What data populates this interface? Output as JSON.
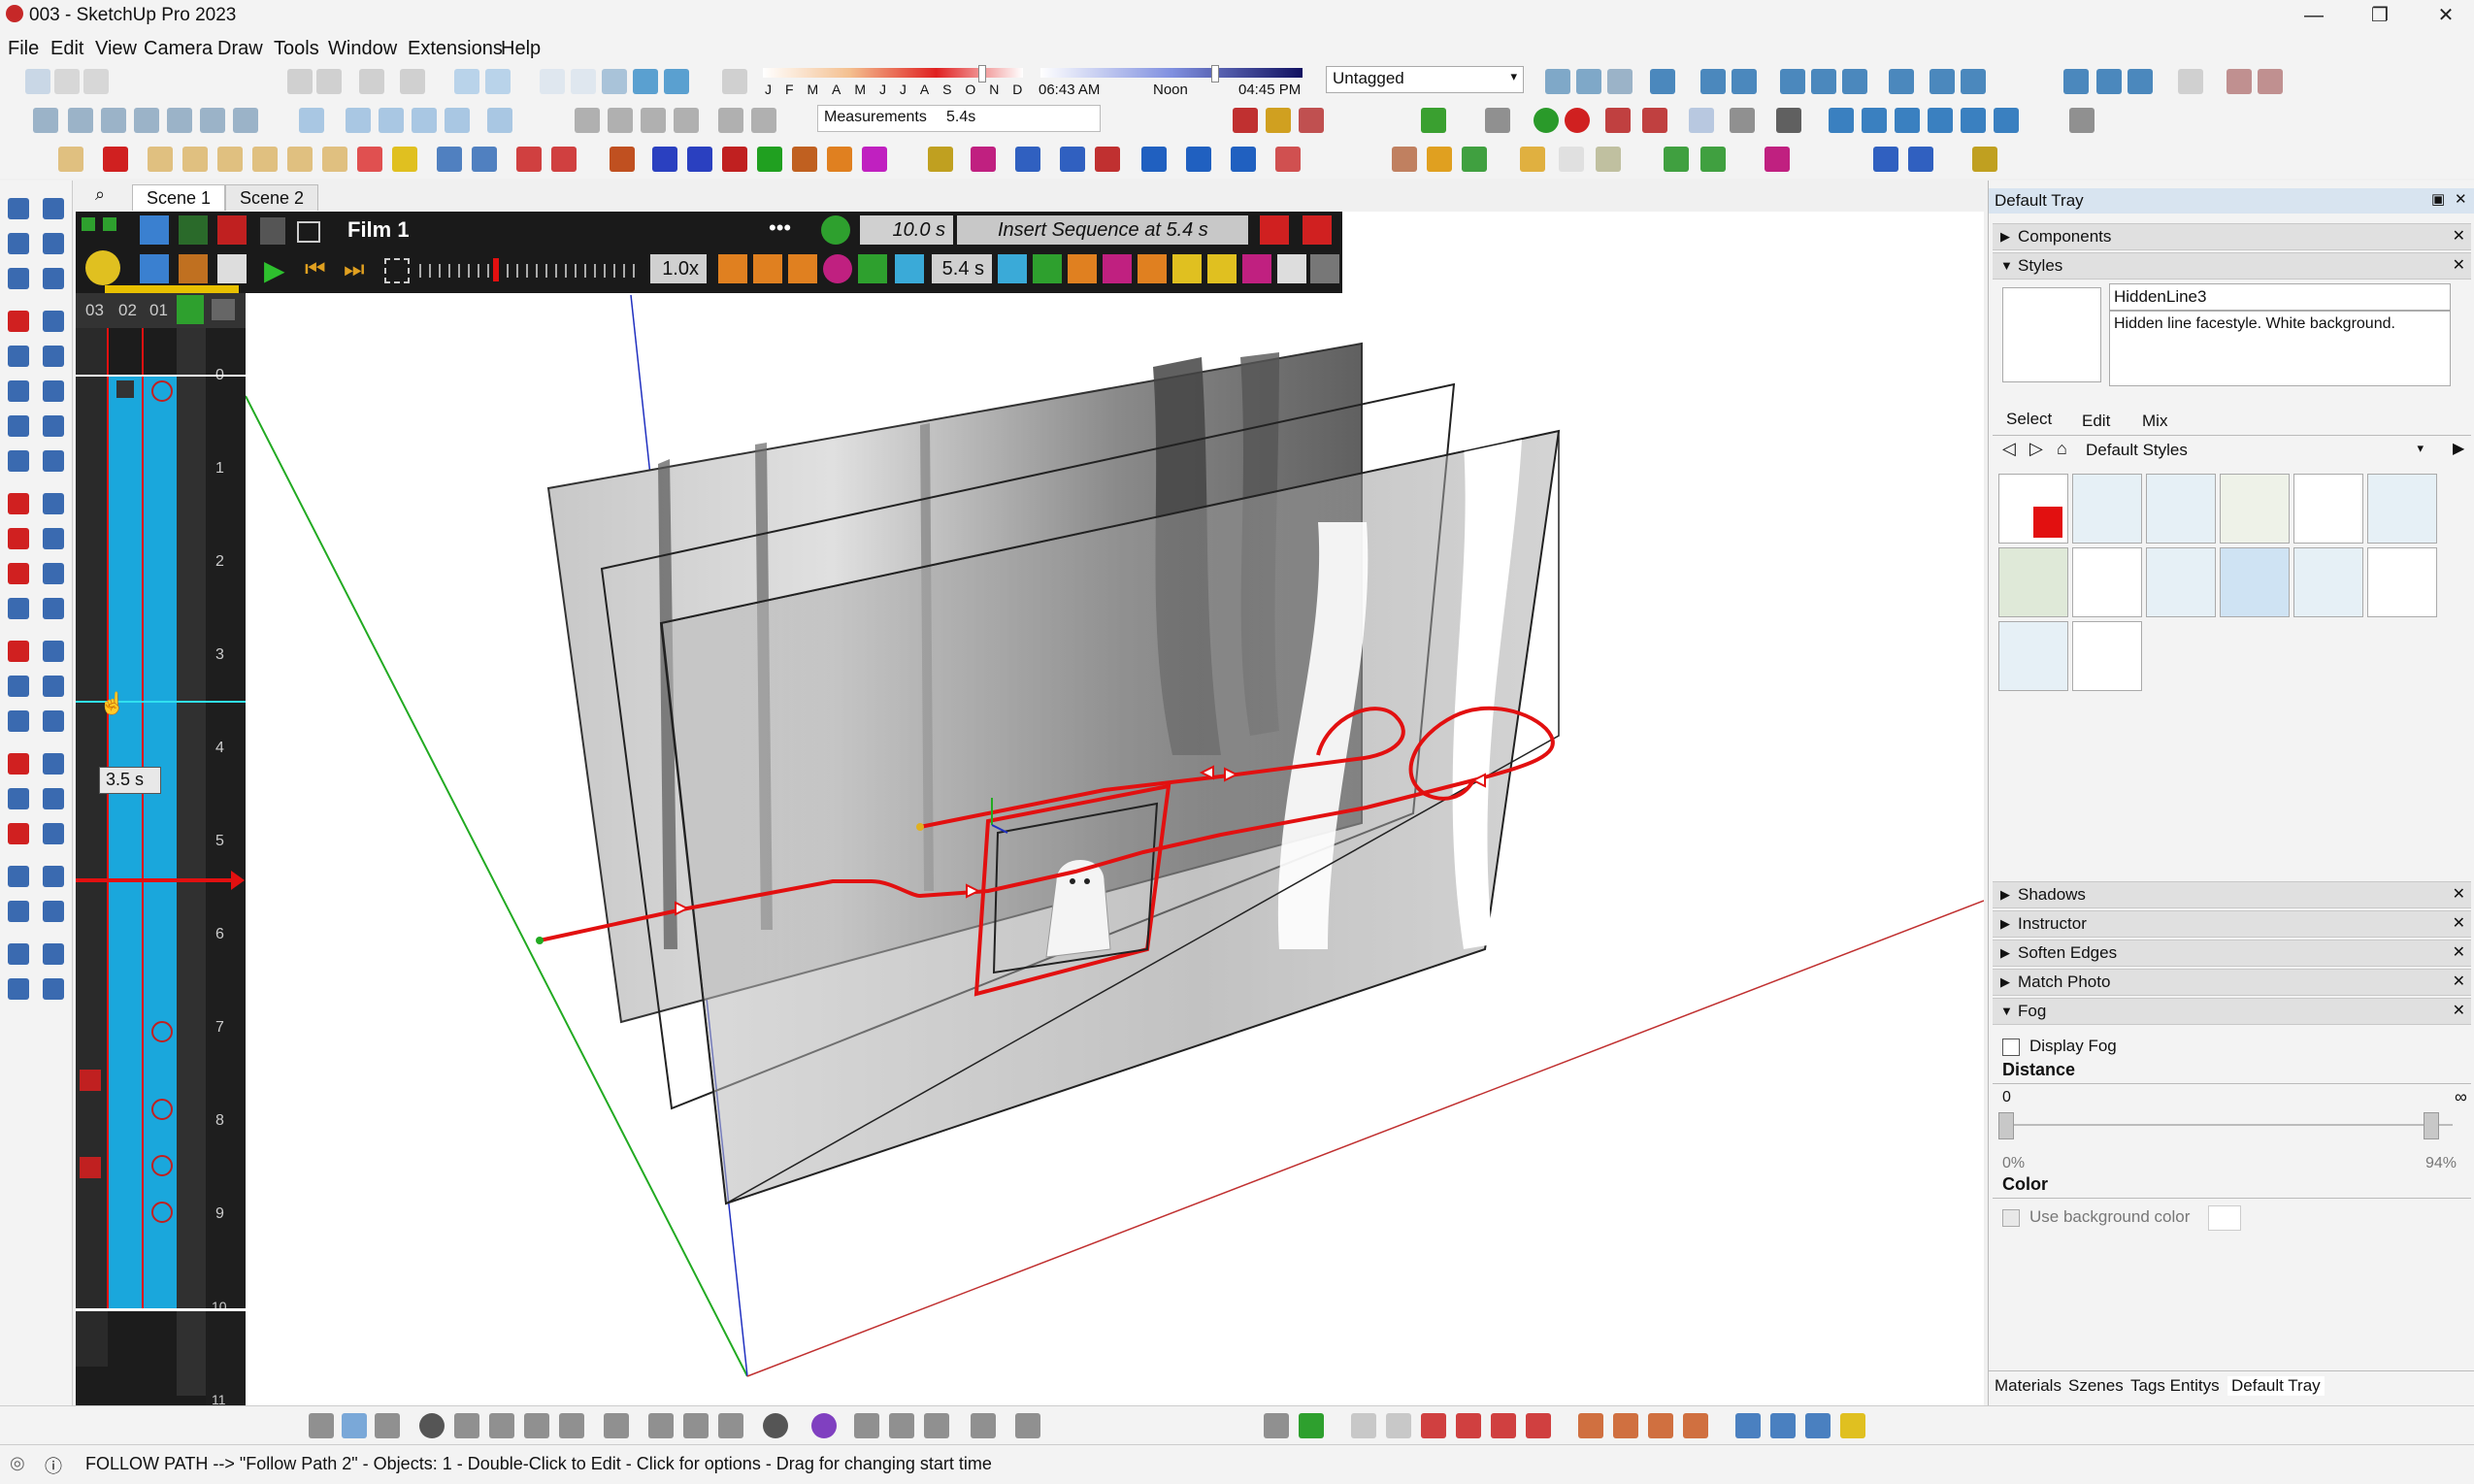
{
  "app": {
    "title": "003 - SketchUp Pro 2023"
  },
  "menu": [
    "File",
    "Edit",
    "View",
    "Camera",
    "Draw",
    "Tools",
    "Window",
    "Extensions",
    "Help"
  ],
  "shadow_bar": {
    "months": [
      "J",
      "F",
      "M",
      "A",
      "M",
      "J",
      "J",
      "A",
      "S",
      "O",
      "N",
      "D"
    ],
    "time_start": "06:43 AM",
    "time_mid": "Noon",
    "time_end": "04:45 PM"
  },
  "tag_select": {
    "value": "Untagged"
  },
  "measurements": {
    "label": "Measurements",
    "value": "5.4s"
  },
  "scene_tabs": [
    "Scene 1",
    "Scene 2"
  ],
  "film": {
    "name": "Film 1",
    "more": "•••",
    "duration": "10.0 s",
    "insert_label": "Insert Sequence at 5.4 s",
    "speed": "1.0x",
    "current_time": "5.4 s",
    "track_labels": [
      "03",
      "02",
      "01"
    ],
    "ruler": [
      "0",
      "1",
      "2",
      "3",
      "4",
      "5",
      "6",
      "7",
      "8",
      "9",
      "10",
      "11"
    ],
    "tooltip_time": "3.5 s"
  },
  "tray": {
    "title": "Default Tray",
    "components_label": "Components",
    "styles_label": "Styles",
    "style_name": "HiddenLine3",
    "style_desc": "Hidden line facestyle. White background.",
    "tabs": [
      "Select",
      "Edit",
      "Mix"
    ],
    "library": "Default Styles",
    "collapsed_sections": [
      "Shadows",
      "Instructor",
      "Soften Edges",
      "Match Photo"
    ],
    "fog": {
      "label": "Fog",
      "display_fog": "Display Fog",
      "distance_label": "Distance",
      "min": "0",
      "max": "∞",
      "left_pct": "0%",
      "right_pct": "94%",
      "color_label": "Color",
      "use_bg": "Use background color"
    },
    "bottom_tabs": [
      "Materials",
      "Szenes",
      "Tags Entitys",
      "Default Tray"
    ]
  },
  "status": {
    "text": "FOLLOW PATH --> \"Follow Path 2\" - Objects: 1 - Double-Click to Edit - Click for options - Drag for changing start time"
  },
  "colors": {
    "accent_red": "#e21010",
    "timeline_blue": "#1aa7dc",
    "axis_green": "#22aa22",
    "axis_blue": "#2030c0",
    "axis_red": "#c03030"
  },
  "icons": [
    "sketchup-logo-icon",
    "minimize-icon",
    "restore-icon",
    "close-icon",
    "play-icon",
    "gear-icon",
    "ghost-figure"
  ]
}
